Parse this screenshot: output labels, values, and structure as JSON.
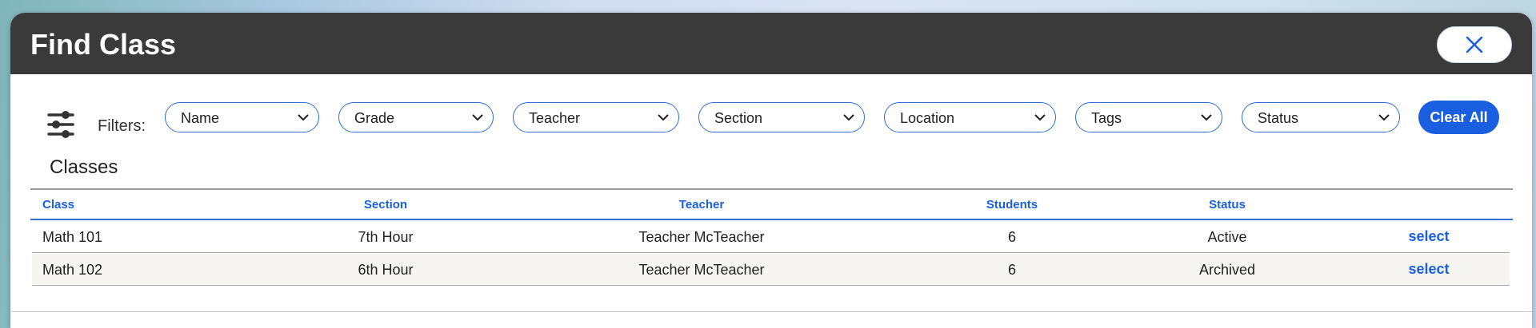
{
  "modal": {
    "title": "Find Class",
    "close_icon": "close-icon"
  },
  "filters": {
    "label": "Filters:",
    "icon": "sliders-icon",
    "items": [
      {
        "label": "Name"
      },
      {
        "label": "Grade"
      },
      {
        "label": "Teacher"
      },
      {
        "label": "Section"
      },
      {
        "label": "Location"
      },
      {
        "label": "Tags"
      },
      {
        "label": "Status"
      }
    ],
    "clear_label": "Clear All"
  },
  "classes": {
    "title": "Classes",
    "columns": [
      "Class",
      "Section",
      "Teacher",
      "Students",
      "Status"
    ],
    "rows": [
      {
        "class": "Math 101",
        "section": "7th Hour",
        "teacher": "Teacher McTeacher",
        "students": "6",
        "status": "Active",
        "action": "select"
      },
      {
        "class": "Math 102",
        "section": "6th Hour",
        "teacher": "Teacher McTeacher",
        "students": "6",
        "status": "Archived",
        "action": "select"
      }
    ]
  },
  "colors": {
    "header_bg": "#3a3a3a",
    "accent": "#1a5fe0",
    "row_alt": "#f6f5f2"
  }
}
